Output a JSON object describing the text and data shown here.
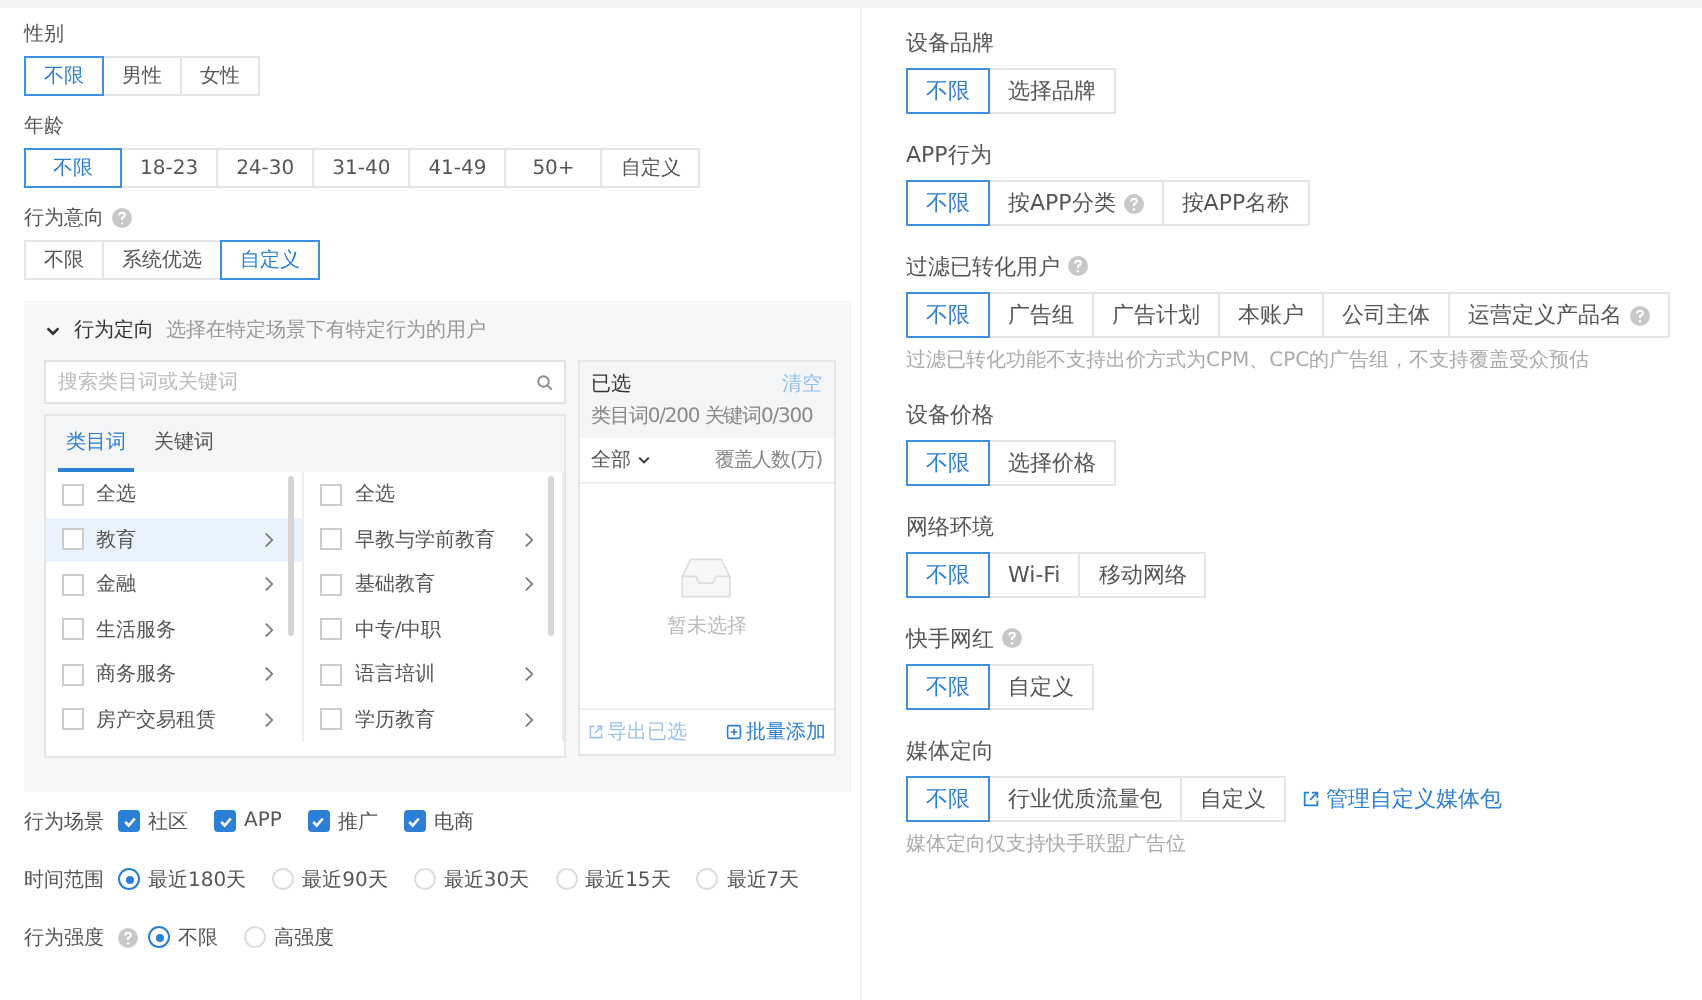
{
  "left": {
    "gender": {
      "label": "性别",
      "options": [
        {
          "label": "不限",
          "selected": true
        },
        {
          "label": "男性",
          "selected": false
        },
        {
          "label": "女性",
          "selected": false
        }
      ]
    },
    "age": {
      "label": "年龄",
      "options": [
        {
          "label": "不限",
          "selected": true
        },
        {
          "label": "18-23",
          "selected": false
        },
        {
          "label": "24-30",
          "selected": false
        },
        {
          "label": "31-40",
          "selected": false
        },
        {
          "label": "41-49",
          "selected": false
        },
        {
          "label": "50+",
          "selected": false
        },
        {
          "label": "自定义",
          "selected": false
        }
      ]
    },
    "intent": {
      "label": "行为意向",
      "help": true,
      "options": [
        {
          "label": "不限",
          "selected": false
        },
        {
          "label": "系统优选",
          "selected": false
        },
        {
          "label": "自定义",
          "selected": true
        }
      ]
    },
    "behavior": {
      "title": "行为定向",
      "hint": "选择在特定场景下有特定行为的用户",
      "expanded": true,
      "search": {
        "placeholder": "搜索类目词或关键词"
      },
      "tabs": [
        {
          "label": "类目词",
          "selected": true
        },
        {
          "label": "关键词",
          "selected": false
        }
      ],
      "column_1": [
        {
          "label": "全选",
          "checked": false,
          "has_children": false,
          "selected": false
        },
        {
          "label": "教育",
          "checked": false,
          "has_children": true,
          "selected": true
        },
        {
          "label": "金融",
          "checked": false,
          "has_children": true,
          "selected": false
        },
        {
          "label": "生活服务",
          "checked": false,
          "has_children": true,
          "selected": false
        },
        {
          "label": "商务服务",
          "checked": false,
          "has_children": true,
          "selected": false
        },
        {
          "label": "房产交易租赁",
          "checked": false,
          "has_children": true,
          "selected": false
        }
      ],
      "column_2": [
        {
          "label": "全选",
          "checked": false,
          "has_children": false,
          "selected": false
        },
        {
          "label": "早教与学前教育",
          "checked": false,
          "has_children": true,
          "selected": false
        },
        {
          "label": "基础教育",
          "checked": false,
          "has_children": true,
          "selected": false
        },
        {
          "label": "中专/中职",
          "checked": false,
          "has_children": false,
          "selected": false
        },
        {
          "label": "语言培训",
          "checked": false,
          "has_children": true,
          "selected": false
        },
        {
          "label": "学历教育",
          "checked": false,
          "has_children": true,
          "selected": false
        }
      ],
      "chosen": {
        "title": "已选",
        "clear": "清空",
        "counts": "类目词0/200 关键词0/300",
        "filter": "全部",
        "column": "覆盖人数(万)",
        "empty": "暂未选择",
        "export": "导出已选",
        "batch_add": "批量添加"
      }
    },
    "scenes": {
      "label": "行为场景",
      "options": [
        {
          "label": "社区",
          "checked": true
        },
        {
          "label": "APP",
          "checked": true
        },
        {
          "label": "推广",
          "checked": true
        },
        {
          "label": "电商",
          "checked": true
        }
      ]
    },
    "time_range": {
      "label": "时间范围",
      "options": [
        {
          "label": "最近180天",
          "selected": true
        },
        {
          "label": "最近90天",
          "selected": false
        },
        {
          "label": "最近30天",
          "selected": false
        },
        {
          "label": "最近15天",
          "selected": false
        },
        {
          "label": "最近7天",
          "selected": false
        }
      ]
    },
    "strength": {
      "label": "行为强度",
      "help": true,
      "options": [
        {
          "label": "不限",
          "selected": true
        },
        {
          "label": "高强度",
          "selected": false
        }
      ]
    }
  },
  "right": [
    {
      "label": "设备品牌",
      "help": false,
      "options": [
        {
          "label": "不限",
          "selected": true,
          "help": false
        },
        {
          "label": "选择品牌",
          "selected": false,
          "help": false
        }
      ]
    },
    {
      "label": "APP行为",
      "help": false,
      "options": [
        {
          "label": "不限",
          "selected": true,
          "help": false
        },
        {
          "label": "按APP分类",
          "selected": false,
          "help": true
        },
        {
          "label": "按APP名称",
          "selected": false,
          "help": false
        }
      ]
    },
    {
      "label": "过滤已转化用户",
      "help": true,
      "options": [
        {
          "label": "不限",
          "selected": true,
          "help": false
        },
        {
          "label": "广告组",
          "selected": false,
          "help": false
        },
        {
          "label": "广告计划",
          "selected": false,
          "help": false
        },
        {
          "label": "本账户",
          "selected": false,
          "help": false
        },
        {
          "label": "公司主体",
          "selected": false,
          "help": false
        },
        {
          "label": "运营定义产品名",
          "selected": false,
          "help": true
        }
      ],
      "note": "过滤已转化功能不支持出价方式为CPM、CPC的广告组，不支持覆盖受众预估"
    },
    {
      "label": "设备价格",
      "help": false,
      "options": [
        {
          "label": "不限",
          "selected": true,
          "help": false
        },
        {
          "label": "选择价格",
          "selected": false,
          "help": false
        }
      ]
    },
    {
      "label": "网络环境",
      "help": false,
      "options": [
        {
          "label": "不限",
          "selected": true,
          "help": false
        },
        {
          "label": "Wi-Fi",
          "selected": false,
          "help": false
        },
        {
          "label": "移动网络",
          "selected": false,
          "help": false
        }
      ]
    },
    {
      "label": "快手网红",
      "help": true,
      "options": [
        {
          "label": "不限",
          "selected": true,
          "help": false
        },
        {
          "label": "自定义",
          "selected": false,
          "help": false
        }
      ]
    },
    {
      "label": "媒体定向",
      "help": false,
      "options": [
        {
          "label": "不限",
          "selected": true,
          "help": false
        },
        {
          "label": "行业优质流量包",
          "selected": false,
          "help": false
        },
        {
          "label": "自定义",
          "selected": false,
          "help": false
        }
      ],
      "link": "管理自定义媒体包",
      "note": "媒体定向仅支持快手联盟广告位"
    }
  ]
}
